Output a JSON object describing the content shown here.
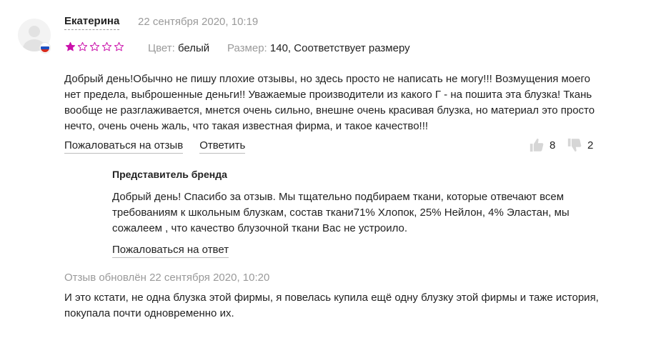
{
  "review": {
    "author": "Екатерина",
    "date": "22 сентября 2020, 10:19",
    "rating": 1,
    "rating_max": 5,
    "colors": {
      "star_filled": "#cb11ab",
      "star_empty": "#cb11ab",
      "muted_text": "#9a9a9a",
      "icon_gray": "#d6d6d6"
    },
    "color_label": "Цвет:",
    "color_value": "белый",
    "size_label": "Размер:",
    "size_value": "140, Соответствует размеру",
    "text": "Добрый день!Обычно не пишу плохие отзывы, но здесь просто не написать не могу!!! Возмущения моего нет предела, выброшенные деньги!! Уважаемые производители из какого Г - на пошита эта блузка! Ткань вообще не разглаживается, мнется очень сильно, внешне очень красивая блузка, но материал это просто нечто, очень очень жаль, что такая известная фирма, и такое качество!!!",
    "complain_label": "Пожаловаться на отзыв",
    "reply_label": "Ответить",
    "likes": "8",
    "dislikes": "2",
    "icons": {
      "like": "thumbs-up-icon",
      "dislike": "thumbs-down-icon",
      "flag": "russia-flag-icon",
      "avatar": "user-avatar-icon"
    }
  },
  "brand_reply": {
    "title": "Представитель бренда",
    "text": "Добрый день! Спасибо за отзыв. Мы тщательно подбираем ткани, которые отвечают всем требованиям к школьным блузкам, состав ткани71% Хлопок, 25% Нейлон, 4% Эластан, мы сожалеем , что качество блузочной ткани Вас не устроило.",
    "complain_label": "Пожаловаться на ответ"
  },
  "update": {
    "label": "Отзыв обновлён 22 сентября 2020, 10:20",
    "text": "И это кстати, не одна блузка этой фирмы, я повелась купила ещё одну блузку этой фирмы и таже история, покупала почти одновременно их."
  }
}
